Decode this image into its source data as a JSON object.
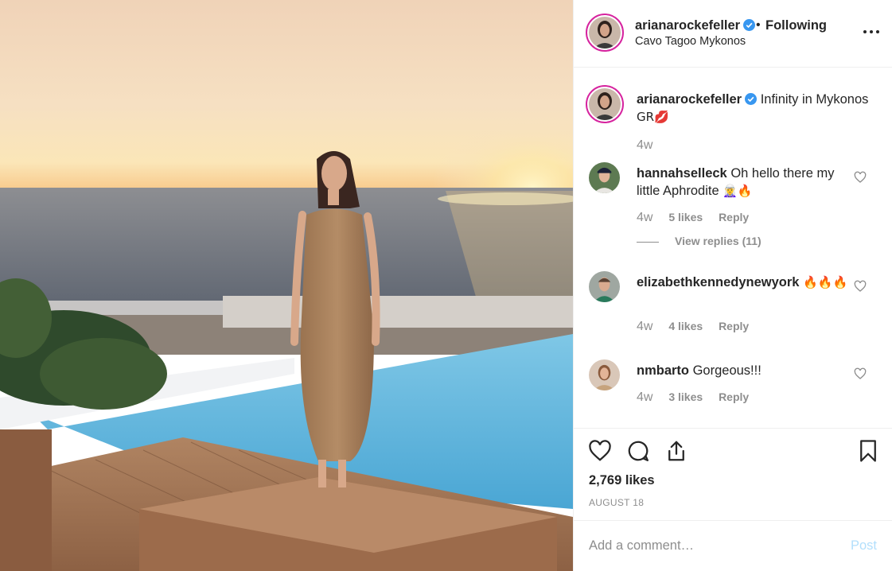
{
  "post": {
    "username": "arianarockefeller",
    "separator": "•",
    "following_label": "Following",
    "location": "Cavo Tagoo Mykonos",
    "caption_text": "Infinity in Mykonos",
    "caption_emoji": "GR💋",
    "caption_time": "4w",
    "likes": "2,769 likes",
    "date": "AUGUST 18"
  },
  "comments": [
    {
      "username": "hannahselleck",
      "text": "Oh hello there my little Aphrodite",
      "emoji": "🧝‍♀️🔥",
      "time": "4w",
      "likes": "5 likes",
      "reply": "Reply",
      "view_replies": "View replies (11)"
    },
    {
      "username": "elizabethkennedynewyork",
      "text": "",
      "emoji": "🔥🔥🔥",
      "time": "4w",
      "likes": "4 likes",
      "reply": "Reply"
    },
    {
      "username": "nmbarto",
      "text": "Gorgeous!!!",
      "emoji": "",
      "time": "4w",
      "likes": "3 likes",
      "reply": "Reply"
    }
  ],
  "add_comment": {
    "placeholder": "Add a comment…",
    "post_label": "Post"
  },
  "icons": {
    "verified": "verified-badge-icon",
    "more": "more-options-icon",
    "like": "heart-icon",
    "comment": "comment-icon",
    "share": "share-icon",
    "save": "bookmark-icon"
  },
  "colors": {
    "verified": "#3897f0",
    "post_disabled": "#b2dffc",
    "story_ring": "#d6249f"
  }
}
